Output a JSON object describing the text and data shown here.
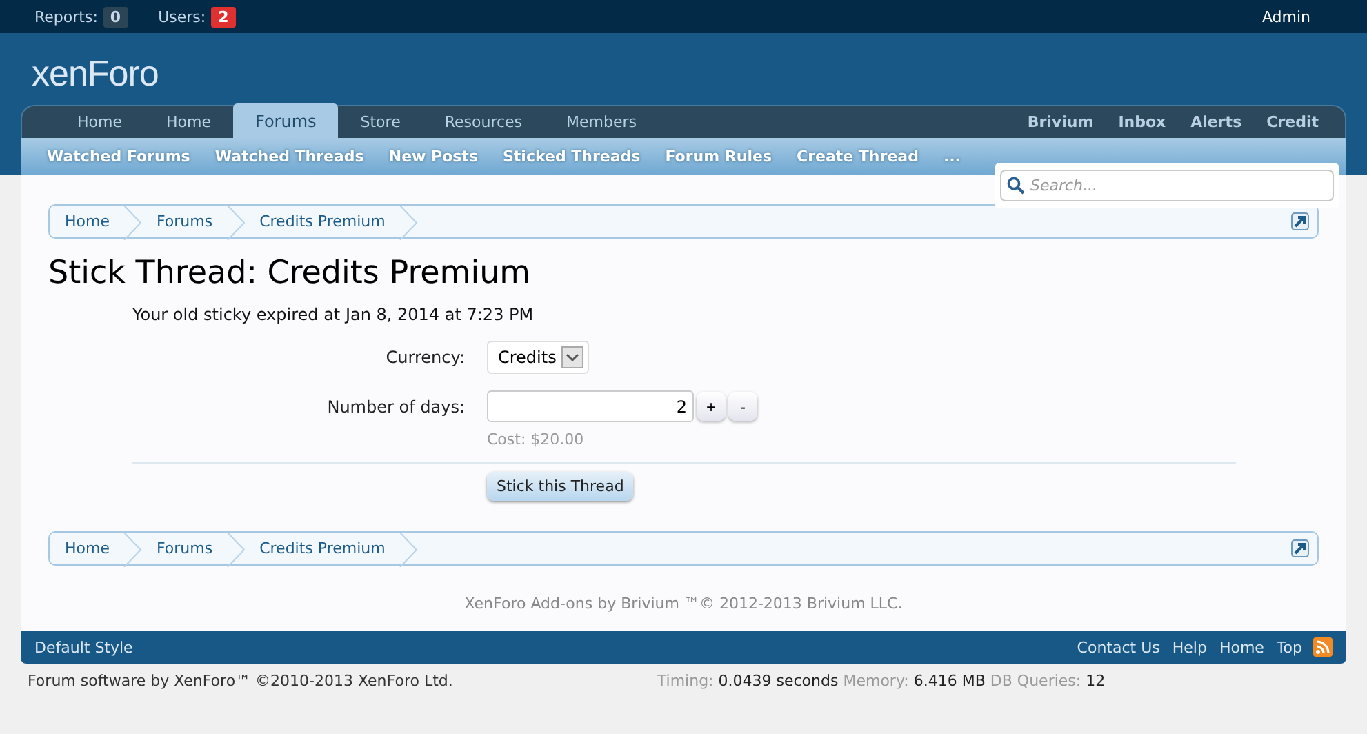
{
  "top_bar": {
    "counters": [
      {
        "label": "Reports:",
        "count": "0",
        "alert": false
      },
      {
        "label": "Users:",
        "count": "2",
        "alert": true
      }
    ],
    "user": "Admin"
  },
  "logo": "xenForo",
  "nav": {
    "tabs": [
      {
        "label": "Home",
        "selected": false
      },
      {
        "label": "Home",
        "selected": false
      },
      {
        "label": "Forums",
        "selected": true
      },
      {
        "label": "Store",
        "selected": false
      },
      {
        "label": "Resources",
        "selected": false
      },
      {
        "label": "Members",
        "selected": false
      }
    ],
    "right_tabs": [
      "Brivium",
      "Inbox",
      "Alerts",
      "Credit"
    ]
  },
  "sub_nav": [
    "Watched Forums",
    "Watched Threads",
    "New Posts",
    "Sticked Threads",
    "Forum Rules",
    "Create Thread",
    "..."
  ],
  "search": {
    "placeholder": "Search..."
  },
  "breadcrumb_top": [
    "Home",
    "Forums",
    "Credits Premium"
  ],
  "title": "Stick Thread: Credits Premium",
  "notice": "Your old sticky expired at Jan 8, 2014 at 7:23 PM",
  "form": {
    "currency_label": "Currency:",
    "currency_value": "Credits",
    "days_label": "Number of days:",
    "days_value": "2",
    "plus": "+",
    "minus": "-",
    "cost": "Cost: $20.00",
    "submit": "Stick this Thread"
  },
  "breadcrumb_bottom": [
    "Home",
    "Forums",
    "Credits Premium"
  ],
  "copyright": "XenForo Add-ons by Brivium ™© 2012-2013 Brivium LLC.",
  "footer": {
    "style": "Default Style",
    "links": [
      "Contact Us",
      "Help",
      "Home",
      "Top"
    ]
  },
  "bottom": {
    "software": "Forum software by XenForo™ ©2010-2013 XenForo Ltd.",
    "stats": [
      {
        "label": "Timing:",
        "value": "0.0439 seconds"
      },
      {
        "label": "Memory:",
        "value": "6.416 MB"
      },
      {
        "label": "DB Queries:",
        "value": "12"
      }
    ]
  }
}
